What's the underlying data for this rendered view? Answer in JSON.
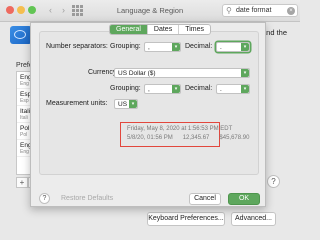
{
  "window": {
    "title": "Language & Region"
  },
  "search": {
    "value": "date format"
  },
  "background": {
    "partial_text": "and the",
    "preferred_label": "Prefe",
    "languages": [
      {
        "name": "Eng",
        "sub": "Eng"
      },
      {
        "name": "Esp",
        "sub": "Esp"
      },
      {
        "name": "Itali",
        "sub": "Itali"
      },
      {
        "name": "Pol",
        "sub": "Pol"
      },
      {
        "name": "Eng",
        "sub": "Eng"
      }
    ],
    "add_label": "+",
    "keyboard_prefs_label": "Keyboard Preferences...",
    "advanced_label": "Advanced...",
    "help_label": "?"
  },
  "sheet": {
    "tabs": [
      {
        "label": "General",
        "active": true
      },
      {
        "label": "Dates",
        "active": false
      },
      {
        "label": "Times",
        "active": false
      }
    ],
    "number_separators_label": "Number separators:",
    "grouping_label": "Grouping:",
    "grouping_value": ",",
    "decimal_label": "Decimal:",
    "decimal_value": ".",
    "currency_label": "Currency:",
    "currency_value": "US Dollar ($)",
    "currency_grouping_label": "Grouping:",
    "currency_grouping_value": ",",
    "currency_decimal_label": "Decimal:",
    "currency_decimal_value": ".",
    "measurement_label": "Measurement units:",
    "measurement_value": "US",
    "sample_line1": "Friday, May 8, 2020 at 1:56:53 PM EDT",
    "sample_line2": "5/8/20, 01:56 PM      12,345.67      $45,678.90",
    "help_label": "?",
    "restore_label": "Restore Defaults",
    "cancel_label": "Cancel",
    "ok_label": "OK"
  },
  "colors": {
    "accent": "#5ea75d",
    "highlight_box": "#e2473d"
  }
}
